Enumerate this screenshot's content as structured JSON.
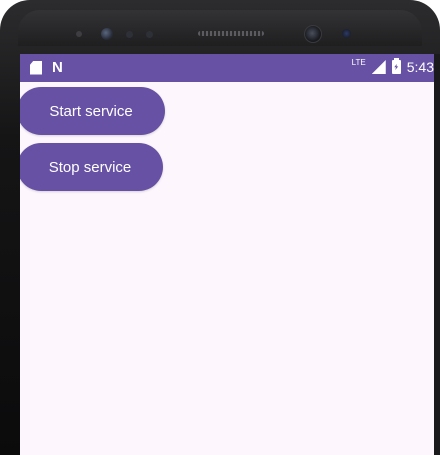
{
  "status_bar": {
    "network_type": "LTE",
    "time": "5:43",
    "left_icons": [
      "sd-card-icon",
      "notification-n-icon"
    ],
    "right_icons": [
      "signal-icon",
      "battery-charging-icon"
    ],
    "color": "#6751a4"
  },
  "main": {
    "buttons": [
      {
        "label": "Start service"
      },
      {
        "label": "Stop service"
      }
    ]
  },
  "colors": {
    "accent": "#6751a4",
    "background": "#fdf6fd"
  }
}
